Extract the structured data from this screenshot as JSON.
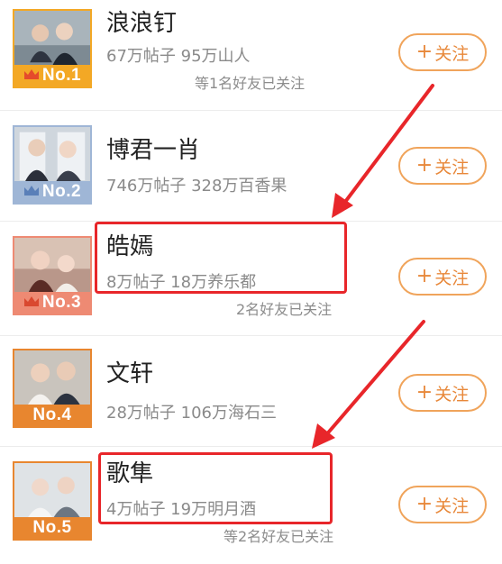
{
  "list": [
    {
      "rank": "No.1",
      "name": "浪浪钉",
      "stats": "67万帖子 95万山人",
      "friends": "等1名好友已关注",
      "follow_label": "关注",
      "badge_color": "#f3a825",
      "crown": true,
      "highlighted": false
    },
    {
      "rank": "No.2",
      "name": "博君一肖",
      "stats": "746万帖子 328万百香果",
      "friends": "",
      "follow_label": "关注",
      "badge_color": "#9fb6d6",
      "crown": true,
      "highlighted": false
    },
    {
      "rank": "No.3",
      "name": "皓嫣",
      "stats": "8万帖子 18万养乐都",
      "friends": "2名好友已关注",
      "follow_label": "关注",
      "badge_color": "#ee8a73",
      "crown": true,
      "highlighted": true
    },
    {
      "rank": "No.4",
      "name": "文轩",
      "stats": "28万帖子 106万海石三",
      "friends": "",
      "follow_label": "关注",
      "badge_color": "#e8862f",
      "crown": false,
      "highlighted": false
    },
    {
      "rank": "No.5",
      "name": "歌隼",
      "stats": "4万帖子 19万明月酒",
      "friends": "等2名好友已关注",
      "follow_label": "关注",
      "badge_color": "#e8862f",
      "crown": false,
      "highlighted": true
    }
  ],
  "colors": {
    "accent": "#e8883a",
    "annotation": "#e8262a"
  }
}
